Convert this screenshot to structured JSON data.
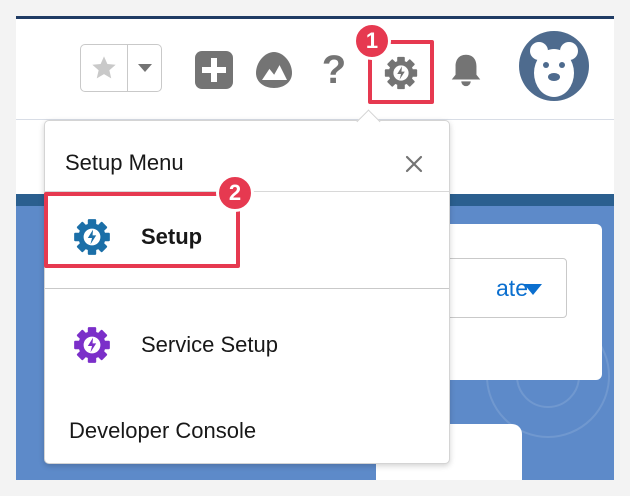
{
  "header": {
    "favorites": {
      "star_icon": "star-icon",
      "caret_icon": "chevron-down-icon"
    },
    "global_actions_icon": "plus-icon",
    "trailhead_icon": "trailhead-icon",
    "help_label": "?",
    "setup_gear_icon": "gear-bolt-icon",
    "notifications_icon": "bell-icon",
    "avatar_icon": "bear-avatar-icon"
  },
  "callouts": {
    "first": "1",
    "second": "2"
  },
  "background": {
    "create_button_label": "ate"
  },
  "setup_menu": {
    "title": "Setup Menu",
    "close_icon": "close-icon",
    "items": [
      {
        "label": "Setup",
        "icon": "gear-bolt-icon",
        "color": "#1b6fa8"
      },
      {
        "label": "Service Setup",
        "icon": "gear-bolt-icon",
        "color": "#7b2fc9"
      },
      {
        "label": "Developer Console"
      }
    ]
  },
  "colors": {
    "highlight": "#e63950",
    "link": "#0b6fcf",
    "gray_icon": "#747474"
  }
}
